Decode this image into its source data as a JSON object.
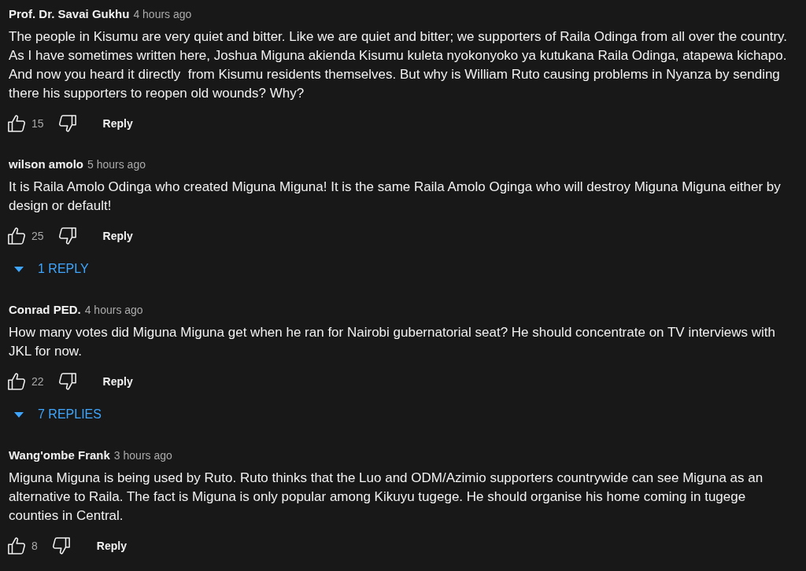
{
  "comments": [
    {
      "author": "Prof. Dr. Savai Gukhu",
      "time": "4 hours ago",
      "text": "The people in Kisumu are very quiet and bitter. Like we are quiet and bitter; we supporters of Raila Odinga from all over the country. As I have sometimes written here, Joshua Miguna akienda Kisumu kuleta nyokonyoko ya kutukana Raila Odinga, atapewa kichapo. And now you heard it directly  from Kisumu residents themselves. But why is William Ruto causing problems in Nyanza by sending there his supporters to reopen old wounds? Why?",
      "likes": "15",
      "reply_label": "Reply"
    },
    {
      "author": "wilson amolo",
      "time": "5 hours ago",
      "text": "It is Raila Amolo Odinga who created Miguna Miguna! It is the same Raila Amolo Oginga who will destroy Miguna Miguna either by design or default!",
      "likes": "25",
      "reply_label": "Reply",
      "replies_toggle": "1 REPLY"
    },
    {
      "author": "Conrad PED.",
      "time": "4 hours ago",
      "text": "How many votes did Miguna Miguna get when he ran for Nairobi gubernatorial seat? He should concentrate on TV interviews with JKL for now.",
      "likes": "22",
      "reply_label": "Reply",
      "replies_toggle": "7 REPLIES"
    },
    {
      "author": "Wang'ombe Frank",
      "time": "3 hours ago",
      "text": "Miguna Miguna is being used by Ruto. Ruto thinks that the Luo and ODM/Azimio supporters countrywide can see Miguna as an alternative to Raila. The fact is Miguna is only popular among Kikuyu tugege. He should organise his home coming in tugege counties in Central.",
      "likes": "8",
      "reply_label": "Reply"
    }
  ]
}
